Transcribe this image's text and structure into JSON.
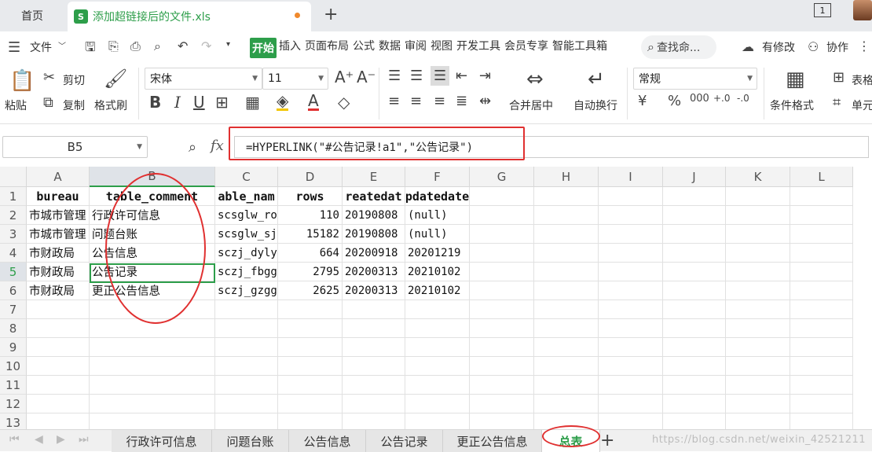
{
  "titlebar": {
    "home_tab": "首页",
    "doc_icon": "S",
    "doc_name": "添加超链接后的文件.xls",
    "new_tab": "+",
    "page_indicator": "1"
  },
  "menubar": {
    "file_label": "文件",
    "tabs": [
      "开始",
      "插入",
      "页面布局",
      "公式",
      "数据",
      "审阅",
      "视图",
      "开发工具",
      "会员专享",
      "智能工具箱"
    ],
    "active_tab": "开始",
    "search_placeholder": "查找命...",
    "modified_label": "有修改",
    "collaborate_label": "协作"
  },
  "ribbon": {
    "paste_label": "粘贴",
    "cut_label": "剪切",
    "copy_label": "复制",
    "format_painter_label": "格式刷",
    "font_name": "宋体",
    "font_size": "11",
    "merge_center_label": "合并居中",
    "wrap_text_label": "自动换行",
    "number_format": "常规",
    "conditional_format_label": "条件格式",
    "table_style_label": "表格",
    "cell_label": "单元",
    "bold_label": "B",
    "italic_label": "I",
    "underline_label": "U",
    "font_color_label": "A",
    "percent_label": "%",
    "currency_label": "¥",
    "thousands_label": "000",
    "inc_decimal_label": "+.0",
    "dec_decimal_label": "-.0"
  },
  "formulabar": {
    "cell_ref": "B5",
    "fx_label": "fx",
    "formula": "=HYPERLINK(\"#公告记录!a1\",\"公告记录\")"
  },
  "grid": {
    "columns": [
      "A",
      "B",
      "C",
      "D",
      "E",
      "F",
      "G",
      "H",
      "I",
      "J",
      "K",
      "L"
    ],
    "selected_column": "B",
    "rows": [
      "1",
      "2",
      "3",
      "4",
      "5",
      "6",
      "7",
      "8",
      "9",
      "10",
      "11",
      "12",
      "13"
    ],
    "selected_row": "5",
    "header": [
      "bureau",
      "table_comment",
      "able_nam",
      "rows",
      "reatedat",
      "pdatedate"
    ],
    "data": [
      [
        "市城市管理",
        "行政许可信息",
        "scsglw_ro",
        "110",
        "20190808",
        "(null)"
      ],
      [
        "市城市管理",
        "问题台账",
        "scsglw_sj",
        "15182",
        "20190808",
        "(null)"
      ],
      [
        "市财政局",
        "公告信息",
        "sczj_dyly",
        "664",
        "20200918",
        "20201219"
      ],
      [
        "市财政局",
        "公告记录",
        "sczj_fbgg",
        "2795",
        "20200313",
        "20210102"
      ],
      [
        "市财政局",
        "更正公告信息",
        "sczj_gzgg",
        "2625",
        "20200313",
        "20210102"
      ]
    ]
  },
  "sheets": {
    "tabs": [
      "行政许可信息",
      "问题台账",
      "公告信息",
      "公告记录",
      "更正公告信息",
      "总表"
    ],
    "active": "总表",
    "add_label": "+"
  },
  "watermark": "https://blog.csdn.net/weixin_42521211",
  "colors": {
    "accent_green": "#2d9e4a",
    "annotation_red": "#e03030",
    "tab_modified_dot": "#f0892c"
  }
}
